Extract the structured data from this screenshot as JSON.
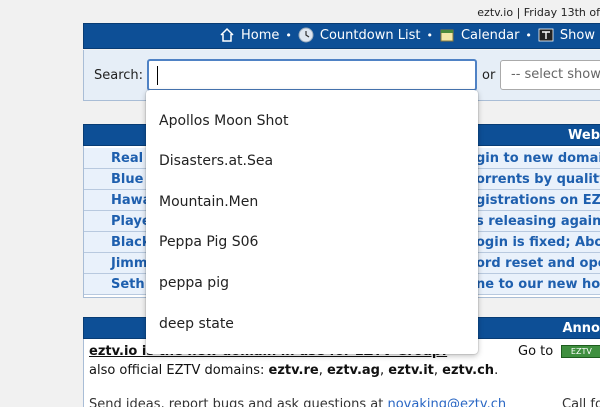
{
  "top_bar": {
    "text": "eztv.io | Friday 13th of"
  },
  "nav": {
    "items": [
      {
        "label": "Home",
        "icon": "home-icon"
      },
      {
        "label": "Countdown List",
        "icon": "clock-icon"
      },
      {
        "label": "Calendar",
        "icon": "calendar-icon"
      },
      {
        "label": "Show",
        "icon": "tv-icon"
      }
    ],
    "separator": "•"
  },
  "search": {
    "label": "Search:",
    "value": "",
    "or_text": "or",
    "select_placeholder": "-- select show"
  },
  "autocomplete": {
    "items": [
      "Apollos Moon Shot",
      "Disasters.at.Sea",
      "Mountain.Men",
      "Peppa Pig S06",
      "peppa pig",
      "deep state"
    ]
  },
  "news": {
    "header": "Web",
    "rows": [
      {
        "left": "Real",
        "right": "gin to new domain"
      },
      {
        "left": "Blue",
        "right": "orrents by quality"
      },
      {
        "left": "Hawa",
        "right": "gistrations on EZTV"
      },
      {
        "left": "Playe",
        "right": "s releasing again!"
      },
      {
        "left": "Black",
        "right": "ogin is fixed; Abou"
      },
      {
        "left": "Jimm",
        "right": "ord reset and oper"
      },
      {
        "left": "Seth",
        "right": "ne to our new hom"
      }
    ]
  },
  "announcements": {
    "header": "Anno",
    "line1": "eztv.io is the new domain in use for EZTV Group!",
    "goto_label": "Go to",
    "goto_badge": "EZTV",
    "line2_prefix": "also official EZTV domains: ",
    "domains": [
      "eztv.re",
      "eztv.ag",
      "eztv.it",
      "eztv.ch"
    ],
    "line3_prefix": "Send ideas, report bugs and ask questions at ",
    "email": "novaking@eztv.ch",
    "call": "Call fo"
  },
  "colors": {
    "nav_blue": "#0d4f96",
    "link_blue": "#1e5fae",
    "input_border": "#4f82c5"
  }
}
